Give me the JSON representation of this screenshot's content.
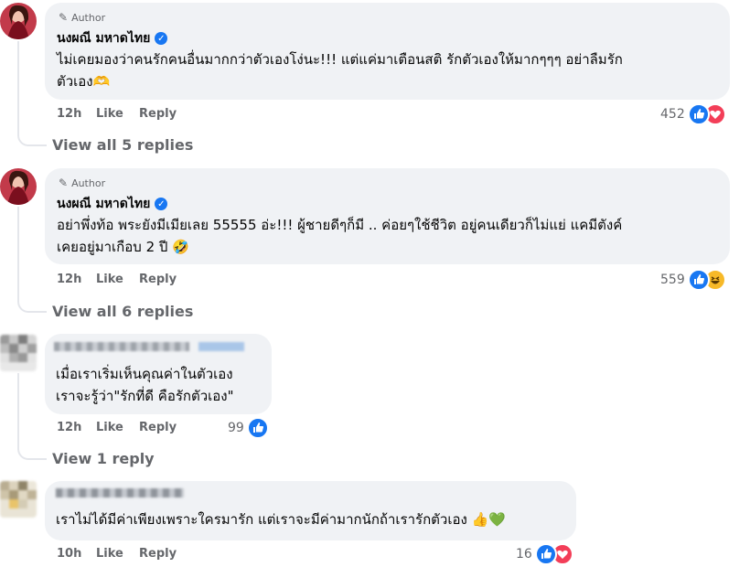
{
  "comments": [
    {
      "author_tag": "Author",
      "name": "นงผณี มหาดไทย",
      "lines": [
        "ไม่เคยมองว่าคนรักคนอื่นมากกว่าตัวเองโง่นะ!!! แต่แค่มาเตือนสติ รักตัวเองให้มากๆๆๆ อย่าลืมรัก",
        "ตัวเอง🫶"
      ],
      "time": "12h",
      "like": "Like",
      "reply": "Reply",
      "reaction_count": "452",
      "view_replies": "View all 5 replies"
    },
    {
      "author_tag": "Author",
      "name": "นงผณี มหาดไทย",
      "lines": [
        "อย่าพึ่งท้อ พระยังมีเมียเลย 55555 อ่ะ!!! ผู้ชายดีๆก็มี .. ค่อยๆใช้ชีวิต อยู่คนเดียวก็ไม่แย่ แคมีตังค์",
        "เคยอยู่มาเกือบ 2 ปี 🤣"
      ],
      "time": "12h",
      "like": "Like",
      "reply": "Reply",
      "reaction_count": "559",
      "view_replies": "View all 6 replies"
    },
    {
      "lines": [
        "เมื่อเราเริ่มเห็นคุณค่าในตัวเอง",
        "เราจะรู้ว่า\"รักที่ดี คือรักตัวเอง\""
      ],
      "time": "12h",
      "like": "Like",
      "reply": "Reply",
      "reaction_count": "99",
      "view_replies": "View 1 reply"
    },
    {
      "lines": [
        "เราไม่ได้มีค่าเพียงเพราะใครมารัก แต่เราจะมีค่ามากนักถ้าเรารักตัวเอง 👍💚"
      ],
      "time": "10h",
      "like": "Like",
      "reply": "Reply",
      "reaction_count": "16"
    }
  ],
  "colors": {
    "like_blue": "#1877f2",
    "love_red": "#f33e58",
    "haha_yellow": "#f7b928",
    "verified": "#1877f2"
  },
  "icons": {
    "author": "pencil-icon",
    "verified": "verified-badge-icon",
    "like": "like-reaction-icon",
    "love": "love-reaction-icon",
    "haha": "haha-reaction-icon"
  }
}
